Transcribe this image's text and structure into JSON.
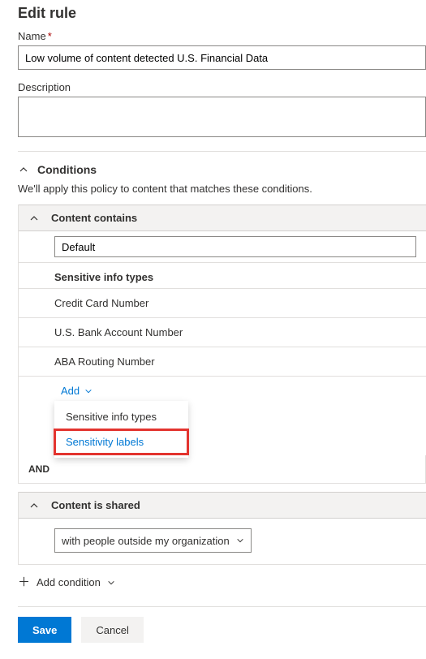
{
  "page": {
    "title": "Edit rule"
  },
  "fields": {
    "name_label": "Name",
    "name_value": "Low volume of content detected U.S. Financial Data",
    "desc_label": "Description",
    "desc_value": ""
  },
  "conditions": {
    "header": "Conditions",
    "subtext": "We'll apply this policy to content that matches these conditions.",
    "content_contains": {
      "label": "Content contains",
      "default_value": "Default",
      "subgroup_label": "Sensitive info types",
      "types": [
        "Credit Card Number",
        "U.S. Bank Account Number",
        "ABA Routing Number"
      ],
      "add_label": "Add",
      "dropdown": {
        "item1": "Sensitive info types",
        "item2": "Sensitivity labels"
      }
    },
    "operator": "AND",
    "content_shared": {
      "label": "Content is shared",
      "selected": "with people outside my organization"
    },
    "add_condition": "Add condition"
  },
  "footer": {
    "save": "Save",
    "cancel": "Cancel"
  }
}
